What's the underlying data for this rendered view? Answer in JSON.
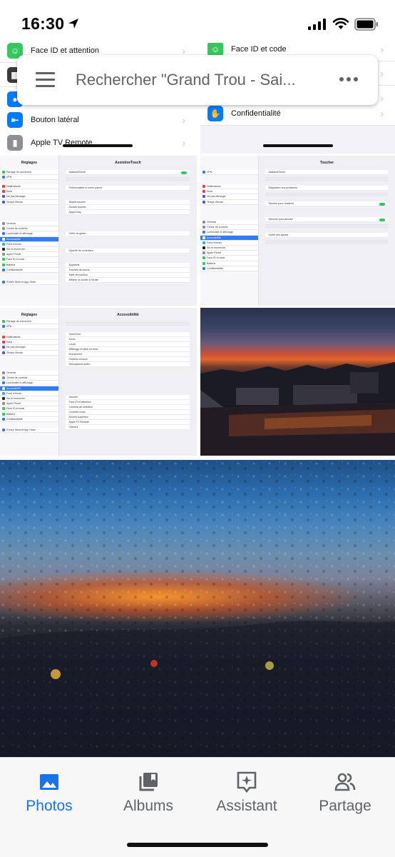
{
  "status_bar": {
    "time": "16:30"
  },
  "search": {
    "placeholder": "Rechercher \"Grand Trou - Sai..."
  },
  "settings_tile_left": {
    "items": [
      {
        "label": "Face ID et attention",
        "color": "#34c759"
      },
      {
        "label": "",
        "color": "#3a3a3c"
      },
      {
        "label": "",
        "color": "#007aff"
      },
      {
        "label": "Bouton latéral",
        "color": "#007aff"
      },
      {
        "label": "Apple TV Remote",
        "color": "#8e8e93"
      }
    ]
  },
  "settings_tile_right": {
    "items": [
      {
        "label": "Face ID et code",
        "color": "#34c759"
      },
      {
        "label": "",
        "color": "#ffffff"
      },
      {
        "label": "",
        "color": "#ffffff"
      },
      {
        "label": "Confidentialité",
        "color": "#007aff"
      }
    ]
  },
  "ipad_sidebar": {
    "title": "Réglages",
    "items": [
      {
        "label": "Partage de connexion",
        "color": "#34c759"
      },
      {
        "label": "VPN",
        "color": "#2f7cf6"
      },
      {
        "label": "Notifications",
        "color": "#ff3b30"
      },
      {
        "label": "Sons",
        "color": "#ff2d55"
      },
      {
        "label": "Ne pas déranger",
        "color": "#5856d6"
      },
      {
        "label": "Temps d'écran",
        "color": "#5856d6"
      },
      {
        "label": "Général",
        "color": "#8e8e93"
      },
      {
        "label": "Centre de contrôle",
        "color": "#8e8e93"
      },
      {
        "label": "Luminosité et affichage",
        "color": "#2f7cf6"
      },
      {
        "label": "Accessibilité",
        "color": "#2f7cf6"
      },
      {
        "label": "Fond d'écran",
        "color": "#32ade6"
      },
      {
        "label": "Siri et recherche",
        "color": "#222222"
      },
      {
        "label": "Apple Pencil",
        "color": "#8e8e93"
      },
      {
        "label": "Face ID et code",
        "color": "#34c759"
      },
      {
        "label": "Batterie",
        "color": "#34c759"
      },
      {
        "label": "Confidentialité",
        "color": "#2f7cf6"
      },
      {
        "label": "iTunes Store et App Store",
        "color": "#2f7cf6"
      }
    ]
  },
  "ipad_assistivetouch": {
    "title": "AssistiveTouch",
    "back": "Toucher",
    "rows": [
      "AssistiveTouch",
      "Personnaliser le menu parent",
      "Simple toucher",
      "Double toucher",
      "Appui long",
      "Créer un geste…",
      "Opacité du contrôleur",
      "Appareils",
      "Touches de souris",
      "Style de pointeur",
      "Afficher le clavier à l'écran"
    ]
  },
  "ipad_toucher": {
    "title": "Toucher",
    "back": "Accessibilité",
    "rows": [
      "AssistiveTouch",
      "Adaptation aux pressions",
      "Toucher pour réactiver",
      "Secouer pour annuler",
      "Sortie des appels"
    ]
  },
  "ipad_accessibilite": {
    "title": "Accessibilité",
    "rows": [
      "VoiceOver",
      "Zoom",
      "Loupe",
      "Affichage et taille du texte",
      "Mouvement",
      "Contenu énoncé",
      "Descriptions audio",
      "Toucher",
      "Face ID et attention",
      "Contrôle de sélection",
      "Contrôle vocal",
      "Bouton supérieur",
      "Apple TV Remote",
      "Claviers"
    ]
  },
  "bottom_nav": {
    "items": [
      {
        "label": "Photos",
        "icon": "photos-icon",
        "active": true
      },
      {
        "label": "Albums",
        "icon": "albums-icon",
        "active": false
      },
      {
        "label": "Assistant",
        "icon": "assistant-icon",
        "active": false
      },
      {
        "label": "Partage",
        "icon": "sharing-icon",
        "active": false
      }
    ],
    "accent_color": "#1a73e8",
    "inactive_color": "#5f6368"
  }
}
